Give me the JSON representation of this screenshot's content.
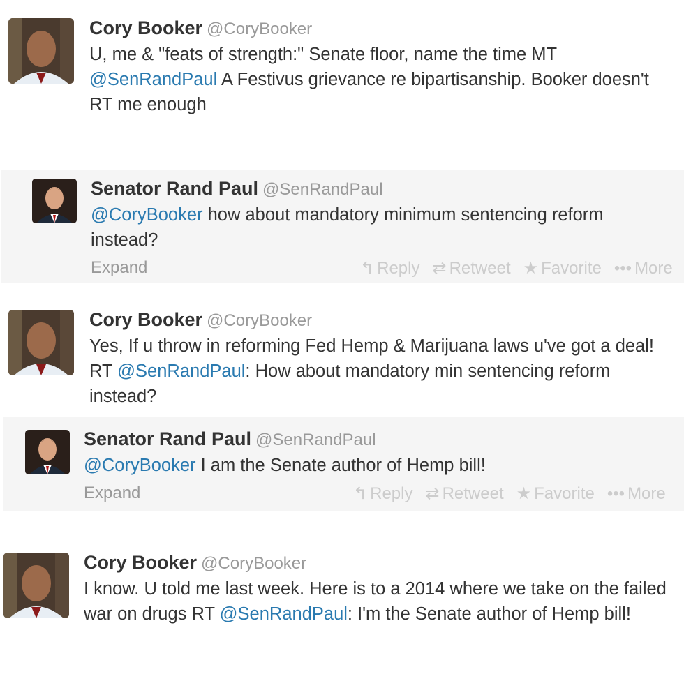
{
  "tweets": [
    {
      "fullname": "Cory Booker",
      "username": "@CoryBooker",
      "text_parts": [
        "U, me & \"feats of strength:\" Senate floor, name the time MT ",
        "@SenRandPaul",
        " A Festivus grievance re bipartisanship. Booker doesn't RT me enough"
      ]
    },
    {
      "fullname": "Senator Rand Paul",
      "username": "@SenRandPaul",
      "text_parts": [
        "@CoryBooker",
        " how about mandatory minimum sentencing reform instead?"
      ],
      "expand_label": "Expand",
      "actions": {
        "reply": "Reply",
        "retweet": "Retweet",
        "favorite": "Favorite",
        "more": "More"
      }
    },
    {
      "fullname": "Cory Booker",
      "username": "@CoryBooker",
      "text_parts": [
        "Yes, If u throw in reforming Fed Hemp & Marijuana laws u've got a deal! RT ",
        "@SenRandPaul",
        ": How about mandatory min sentencing reform instead?"
      ]
    },
    {
      "fullname": "Senator Rand Paul",
      "username": "@SenRandPaul",
      "text_parts": [
        "@CoryBooker",
        " I am the Senate author of Hemp bill!"
      ],
      "expand_label": "Expand",
      "actions": {
        "reply": "Reply",
        "retweet": "Retweet",
        "favorite": "Favorite",
        "more": "More"
      }
    },
    {
      "fullname": "Cory Booker",
      "username": "@CoryBooker",
      "text_parts": [
        "I know. U told me last week. Here is to a 2014 where we take on the failed war on drugs RT ",
        "@SenRandPaul",
        ": I'm the Senate author of Hemp bill!"
      ]
    }
  ],
  "icons": {
    "reply": "reply-icon",
    "retweet": "retweet-icon",
    "favorite": "star-icon",
    "more": "more-dots-icon"
  },
  "colors": {
    "mention": "#2a7ab0",
    "muted": "#999999",
    "action": "#cccccc",
    "shaded_bg": "#f5f5f5"
  }
}
